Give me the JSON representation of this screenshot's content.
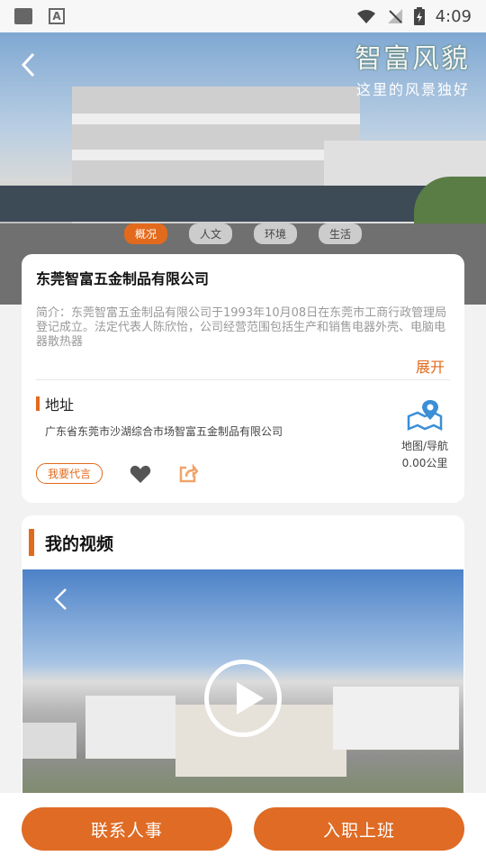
{
  "status_bar": {
    "time": "4:09",
    "icons": [
      "image-icon",
      "font-icon",
      "wifi-icon",
      "signal-off-icon",
      "battery-charging-icon"
    ]
  },
  "hero": {
    "brand_title": "智富风貌",
    "brand_subtitle": "这里的风景独好",
    "tabs": [
      {
        "label": "概况",
        "active": true
      },
      {
        "label": "人文",
        "active": false
      },
      {
        "label": "环境",
        "active": false
      },
      {
        "label": "生活",
        "active": false
      }
    ]
  },
  "company": {
    "name": "东莞智富五金制品有限公司",
    "intro": "简介：东莞智富五金制品有限公司于1993年10月08日在东莞市工商行政管理局登记成立。法定代表人陈欣怡，公司经营范围包括生产和销售电器外壳、电脑电器散热器",
    "expand_label": "展开",
    "address_label": "地址",
    "address": "广东省东莞市沙湖综合市场智富五金制品有限公司",
    "map_label": "地图/导航",
    "distance": "0.00公里",
    "endorse_label": "我要代言"
  },
  "video": {
    "section_title": "我的视频"
  },
  "bottom": {
    "contact_hr": "联系人事",
    "onboard": "入职上班"
  },
  "colors": {
    "accent": "#e26a1c"
  }
}
